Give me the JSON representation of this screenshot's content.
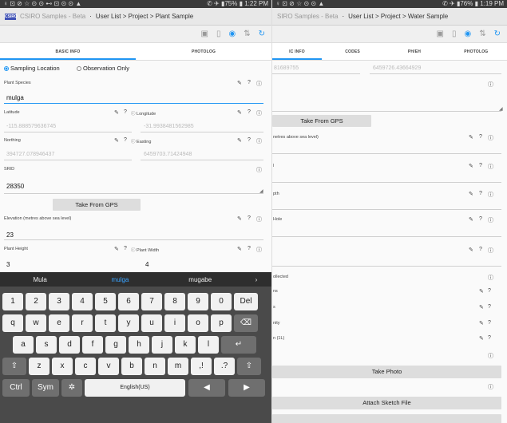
{
  "left": {
    "status": {
      "left": "♀ ⊡ ⊘ ☆ ⊙ ⊙ ⊷ ⊡ ⊙ ⊙ ▲",
      "right": "✆ ✈ ▮75% ▮ 1:22 PM"
    },
    "app_title": "CSIRO Samples - Beta",
    "crumb": "User List > Project > Plant Sample",
    "toolbar_icons": [
      "save-icon",
      "info-icon",
      "locate-icon",
      "sort-icon",
      "refresh-icon"
    ],
    "tabs": [
      "BASIC INFO",
      "PHOTOLOG"
    ],
    "radio": {
      "option1": "Sampling Location",
      "option2": "Observation Only",
      "selected": "Sampling Location"
    },
    "plant_species": {
      "label": "Plant Species",
      "value": "mulga"
    },
    "latitude": {
      "label": "Latitude",
      "value": "-115.888579636745"
    },
    "longitude": {
      "label": "Longitude",
      "value": "-31.9938481562985"
    },
    "northing": {
      "label": "Northing",
      "value": "394727.078946437"
    },
    "easting": {
      "label": "Easting",
      "value": "6459703.71424948"
    },
    "srid": {
      "label": "SRID",
      "value": "28350"
    },
    "gps_button": "Take From GPS",
    "elevation": {
      "label": "Elevation (metres above sea level)",
      "value": "23"
    },
    "plant_height": {
      "label": "Plant Height",
      "value": "3"
    },
    "plant_width": {
      "label": "Plant Width",
      "value": "4"
    },
    "keyboard": {
      "suggestions": [
        "Mula",
        "mulga",
        "mugabe",
        "›"
      ],
      "row1": [
        "1",
        "2",
        "3",
        "4",
        "5",
        "6",
        "7",
        "8",
        "9",
        "0",
        "Del"
      ],
      "row1_sup": [
        "",
        "@",
        "#",
        "$",
        "%",
        "^",
        "&",
        "*",
        "(",
        ")",
        ""
      ],
      "row2": [
        "q",
        "w",
        "e",
        "r",
        "t",
        "y",
        "u",
        "i",
        "o",
        "p",
        "⌫"
      ],
      "row3": [
        "a",
        "s",
        "d",
        "f",
        "g",
        "h",
        "j",
        "k",
        "l",
        "↵"
      ],
      "row4": [
        "⇧",
        "z",
        "x",
        "c",
        "v",
        "b",
        "n",
        "m",
        ",!",
        ".?",
        "⇧"
      ],
      "row5_ctrl": "Ctrl",
      "row5_sym": "Sym",
      "row5_gear": "✲",
      "space": "English(US)",
      "left_arrow": "◀",
      "right_arrow": "▶"
    }
  },
  "right": {
    "status": {
      "left": "♀ ⊡ ⊘ ☆ ⊙ ⊙ ▲",
      "right": "✆ ✈ ▮76% ▮ 1:19 PM"
    },
    "app_title": "SIRO Samples - Beta",
    "crumb": "User List > Project > Water Sample",
    "tabs": [
      "IC INFO",
      "CODES",
      "PH/EH",
      "PHOTOLOG"
    ],
    "coord_left": "81689755",
    "coord_right": "6459726.43664929",
    "gps_button": "Take From GPS",
    "fields": [
      "netres above sea level)",
      "l",
      "pth",
      "Hole"
    ],
    "collected": "ollected",
    "small_labels": [
      "ns",
      "s",
      "nity",
      "n (1L)"
    ],
    "take_photo": "Take Photo",
    "attach_sketch": "Attach Sketch File"
  },
  "icons": {
    "edit": "✎",
    "help": "?",
    "info": "ⓘ"
  }
}
